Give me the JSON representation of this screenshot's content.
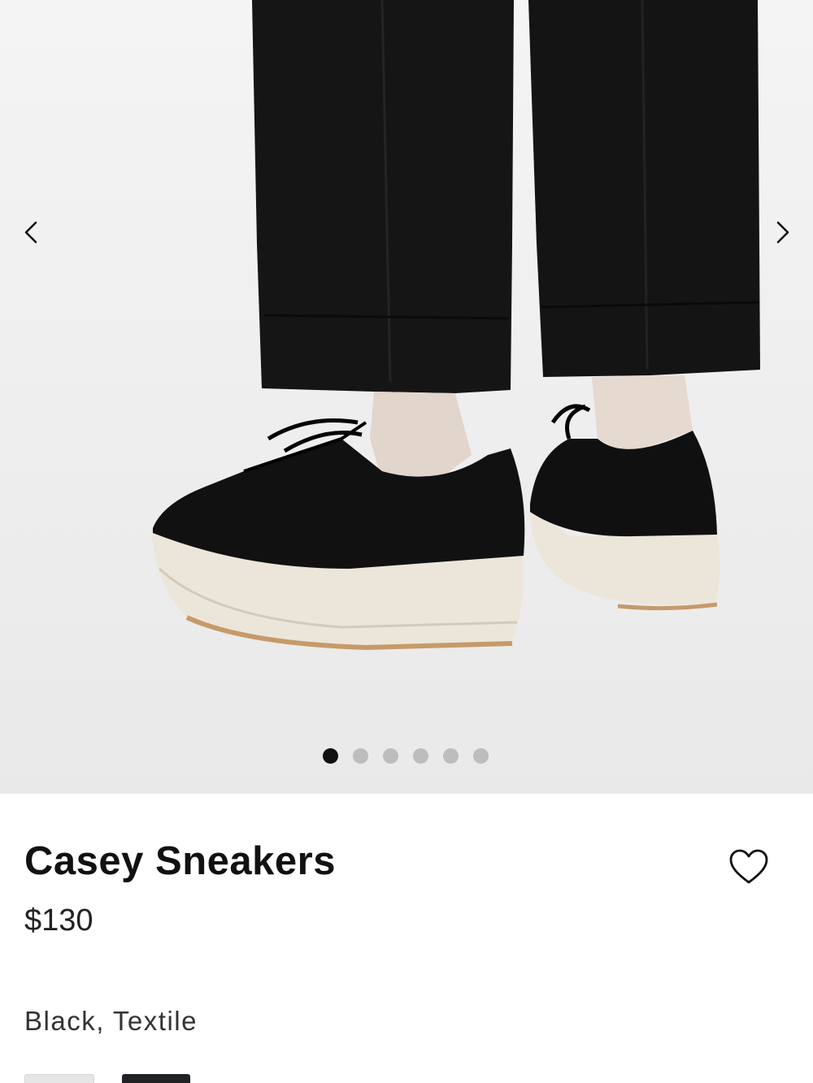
{
  "gallery": {
    "image_count": 6,
    "active_index": 0,
    "prev_icon": "chevron-left-icon",
    "next_icon": "chevron-right-icon"
  },
  "product": {
    "name": "Casey Sneakers",
    "price": "$130",
    "color_material": "Black, Textile",
    "favorite_icon": "heart-outline-icon"
  },
  "swatches": [
    {
      "name": "white-swatch",
      "color": "#e6e6e6"
    },
    {
      "name": "black-swatch",
      "color": "#202226"
    }
  ],
  "colors": {
    "text": "#111111",
    "dot_active": "#111111",
    "dot_inactive": "#bdbdbd",
    "gallery_bg": "#efefef"
  }
}
